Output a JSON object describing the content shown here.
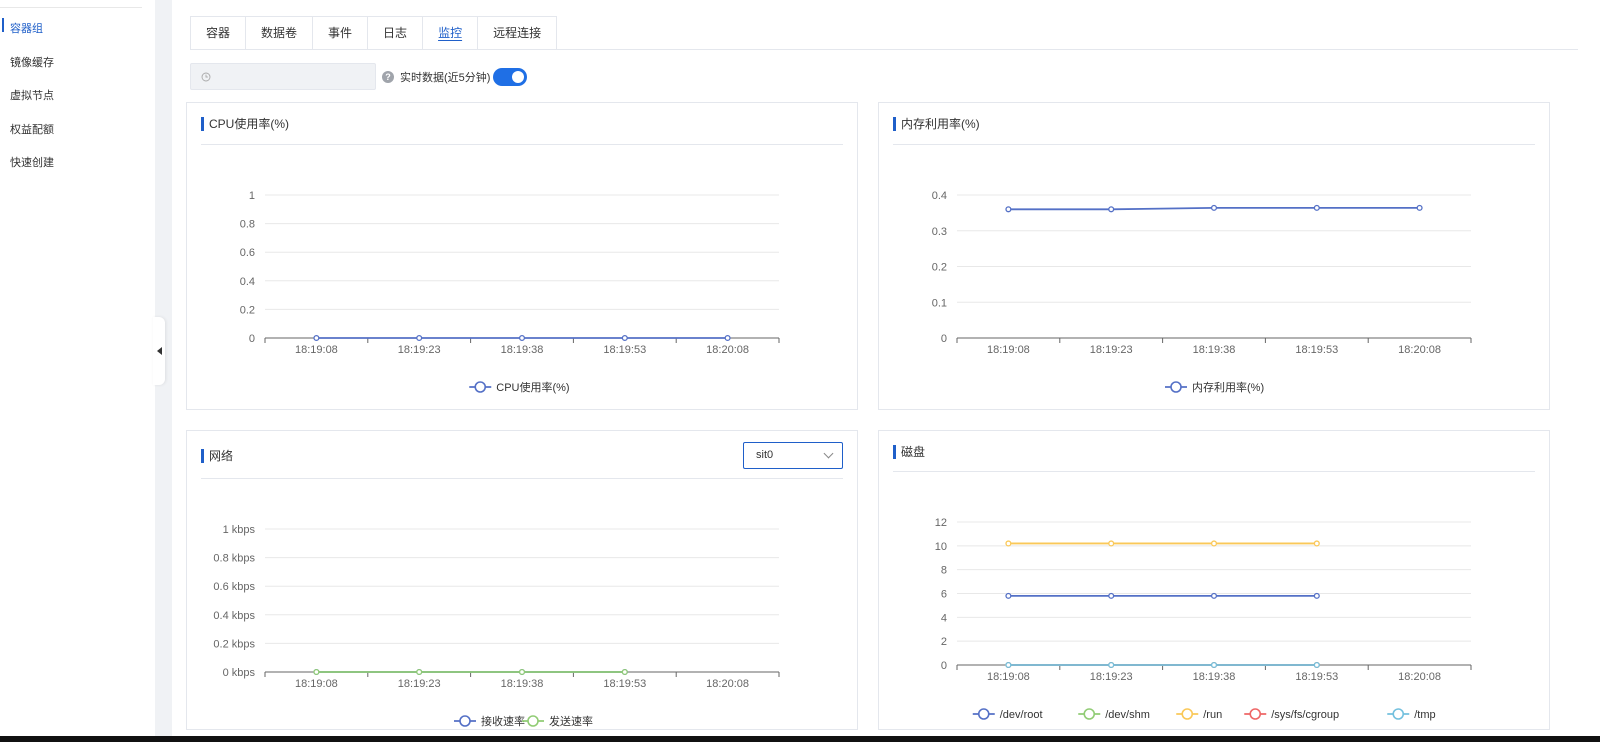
{
  "sidebar": {
    "items": [
      {
        "label": "容器组",
        "active": true
      },
      {
        "label": "镜像缓存",
        "active": false
      },
      {
        "label": "虚拟节点",
        "active": false
      },
      {
        "label": "权益配额",
        "active": false
      },
      {
        "label": "快速创建",
        "active": false
      }
    ]
  },
  "tabs": [
    {
      "label": "容器",
      "active": false
    },
    {
      "label": "数据卷",
      "active": false
    },
    {
      "label": "事件",
      "active": false
    },
    {
      "label": "日志",
      "active": false
    },
    {
      "label": "监控",
      "active": true
    },
    {
      "label": "远程连接",
      "active": false
    }
  ],
  "toolbar": {
    "time_icon": "clock-icon",
    "help_icon": "question-icon",
    "help_glyph": "?",
    "realtime_label": "实时数据(近5分钟)",
    "realtime_enabled": true
  },
  "network_panel": {
    "interface_select": "sit0"
  },
  "colors": {
    "blue": "#5470c6",
    "green": "#91cc75",
    "yellow": "#fac858",
    "red": "#ee6666",
    "cyan": "#73c0de",
    "accent": "#1f5fc9"
  },
  "chart_data": [
    {
      "id": "cpu",
      "type": "line",
      "title": "CPU使用率(%)",
      "x": [
        "18:19:08",
        "18:19:23",
        "18:19:38",
        "18:19:53",
        "18:20:08"
      ],
      "yticks": [
        "0",
        "0.2",
        "0.4",
        "0.6",
        "0.8",
        "1"
      ],
      "ylim": [
        0,
        1
      ],
      "grid": true,
      "legend_position": "bottom",
      "series": [
        {
          "name": "CPU使用率(%)",
          "color": "#5470c6",
          "values": [
            0,
            0,
            0,
            0,
            0
          ]
        }
      ]
    },
    {
      "id": "mem",
      "type": "line",
      "title": "内存利用率(%)",
      "x": [
        "18:19:08",
        "18:19:23",
        "18:19:38",
        "18:19:53",
        "18:20:08"
      ],
      "yticks": [
        "0",
        "0.1",
        "0.2",
        "0.3",
        "0.4"
      ],
      "ylim": [
        0,
        0.4
      ],
      "grid": true,
      "legend_position": "bottom",
      "series": [
        {
          "name": "内存利用率(%)",
          "color": "#5470c6",
          "values": [
            0.36,
            0.36,
            0.364,
            0.364,
            0.364
          ]
        }
      ]
    },
    {
      "id": "net",
      "type": "line",
      "title": "网络",
      "x": [
        "18:19:08",
        "18:19:23",
        "18:19:38",
        "18:19:53",
        "18:20:08"
      ],
      "yticks": [
        "0 kbps",
        "0.2 kbps",
        "0.4 kbps",
        "0.6 kbps",
        "0.8 kbps",
        "1 kbps"
      ],
      "ylim": [
        0,
        1
      ],
      "grid": true,
      "legend_position": "bottom",
      "series": [
        {
          "name": "接收速率",
          "color": "#5470c6",
          "values": [
            0,
            0,
            0,
            0
          ]
        },
        {
          "name": "发送速率",
          "color": "#91cc75",
          "values": [
            0,
            0,
            0,
            0
          ]
        }
      ]
    },
    {
      "id": "disk",
      "type": "line",
      "title": "磁盘",
      "x": [
        "18:19:08",
        "18:19:23",
        "18:19:38",
        "18:19:53",
        "18:20:08"
      ],
      "yticks": [
        "0",
        "2",
        "4",
        "6",
        "8",
        "10",
        "12"
      ],
      "ylim": [
        0,
        12
      ],
      "grid": true,
      "legend_position": "bottom",
      "series": [
        {
          "name": "/dev/root",
          "color": "#5470c6",
          "values": [
            5.8,
            5.8,
            5.8,
            5.8
          ]
        },
        {
          "name": "/dev/shm",
          "color": "#91cc75",
          "values": [
            0,
            0,
            0,
            0
          ]
        },
        {
          "name": "/run",
          "color": "#fac858",
          "values": [
            10.2,
            10.2,
            10.2,
            10.2
          ]
        },
        {
          "name": "/sys/fs/cgroup",
          "color": "#ee6666",
          "values": [
            0,
            0,
            0,
            0
          ]
        },
        {
          "name": "/tmp",
          "color": "#73c0de",
          "values": [
            0,
            0,
            0,
            0
          ]
        }
      ]
    }
  ]
}
